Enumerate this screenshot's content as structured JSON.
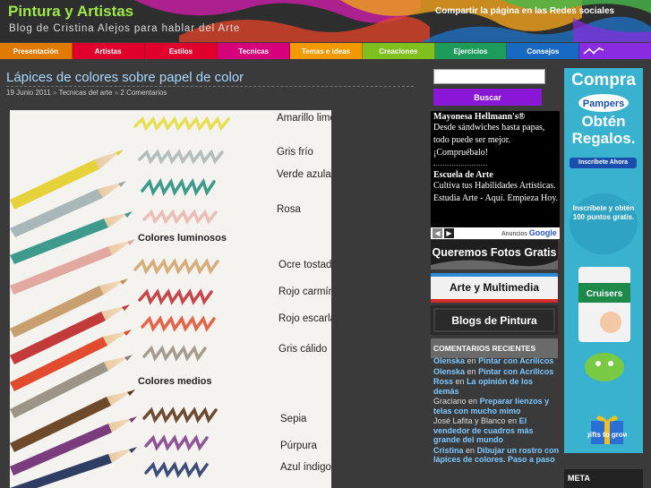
{
  "header": {
    "site_title": "Pintura y Artistas",
    "tagline": "Blog de Cristina Alejos para hablar del Arte",
    "share_link": "Compartir la página en las Redes sociales"
  },
  "nav": {
    "items": [
      {
        "label": "Presentación",
        "color": "#e07b00"
      },
      {
        "label": "Artistas",
        "color": "#e0002b"
      },
      {
        "label": "Estilos",
        "color": "#e0002b"
      },
      {
        "label": "Tecnicas",
        "color": "#d6007a"
      },
      {
        "label": "Temas e ideas",
        "color": "#f29a00"
      },
      {
        "label": "Creaciones",
        "color": "#7fbf1e"
      },
      {
        "label": "Ejercicios",
        "color": "#1c9b5a"
      },
      {
        "label": "Consejos",
        "color": "#1769c2"
      }
    ],
    "extra_icon": "trend-icon",
    "extra_color": "#8a2be2"
  },
  "post": {
    "title": "Lápices de colores sobre papel de color",
    "date": "19 Junio 2011",
    "separator": "»",
    "category": "Tecnicas del arte",
    "comments": "2 Comentarios",
    "image": {
      "labels": [
        "Amarillo limón",
        "Gris frío",
        "Verde azulado",
        "Rosa",
        "Colores luminosos",
        "Ocre tostado",
        "Rojo carmín",
        "Rojo escarlata",
        "Gris cálido",
        "Colores medios",
        "Sepia",
        "Púrpura",
        "Azul índigo"
      ]
    }
  },
  "sidebar": {
    "search_placeholder": "",
    "search_button": "Buscar",
    "ads": {
      "ad1_title": "Mayonesa Hellmann's®",
      "ad1_text": "Desde sándwiches hasta papas, todo puede ser mejor. ¡Compruébalo!",
      "ad2_title": "Escuela de Arte",
      "ad2_text": "Cultiva tus Habilidades Artísticas. Estudia Arte - Aquí. Empieza Hoy.",
      "label_prefix": "Anuncios",
      "label_brand": "Google"
    },
    "banners": {
      "fotos": "Queremos Fotos Gratis",
      "multimedia": "Arte y Multimedia",
      "blogs": "Blogs de Pintura"
    },
    "recent_comments_title": "COMENTARIOS RECIENTES",
    "connector": "en",
    "recent_comments": [
      {
        "author": "Olenska",
        "linked": true,
        "post": "Pintar con Acrílicos"
      },
      {
        "author": "Olenska",
        "linked": true,
        "post": "Pintar con Acrílicos"
      },
      {
        "author": "Ross",
        "linked": true,
        "post": "La opinión de los demás"
      },
      {
        "author": "Graciano",
        "linked": false,
        "post": "Preparar lienzos y telas con mucho mimo"
      },
      {
        "author": "José Lafita y Blanco",
        "linked": false,
        "post": "El vendedor de cuadros más grande del mundo"
      },
      {
        "author": "Cristina",
        "linked": true,
        "post": "Dibujar un rostro con lápices de colores. Paso a paso"
      }
    ]
  },
  "pampers_ad": {
    "headline": "Compra",
    "brand": "Pampers",
    "offer": "Obtén Regalos.",
    "button": "Inscríbete Ahora",
    "badge": "Inscríbete y obtén 100 puntos gratis.",
    "product": "Cruisers",
    "footer": "gifts to grow"
  },
  "meta_title": "META"
}
